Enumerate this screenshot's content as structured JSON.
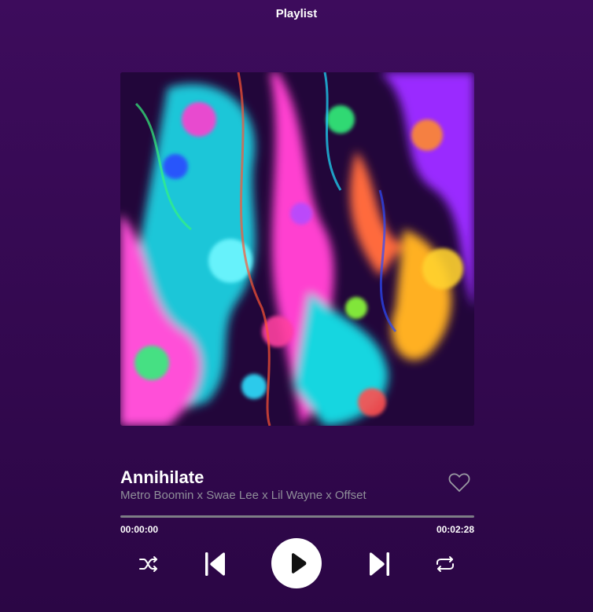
{
  "header": {
    "title": "Playlist"
  },
  "track": {
    "title": "Annihilate",
    "artist": "Metro Boomin x Swae Lee x Lil Wayne x Offset",
    "liked": false
  },
  "progress": {
    "current": "00:00:00",
    "duration": "00:02:28",
    "fraction": 0
  },
  "controls": [
    "shuffle-icon",
    "previous-icon",
    "play-icon",
    "next-icon",
    "repeat-icon"
  ],
  "colors": {
    "background": "#3d0c5c",
    "text_secondary": "#8f8f99",
    "progress_track": "#7d7d86"
  }
}
